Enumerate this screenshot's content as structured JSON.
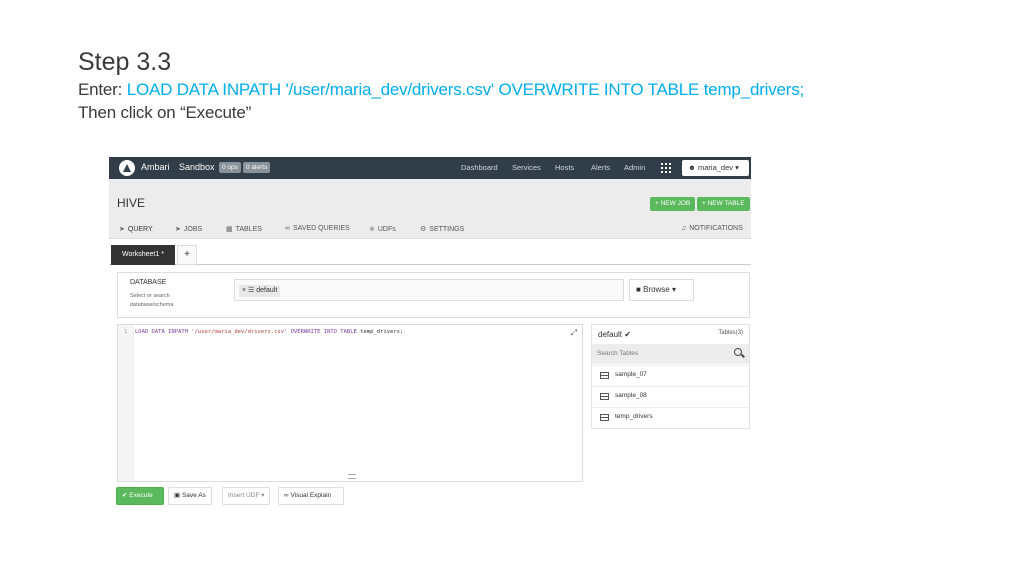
{
  "slide": {
    "title": "Step 3.3",
    "enter_prefix": "Enter: ",
    "command": "LOAD DATA INPATH '/user/maria_dev/drivers.csv' OVERWRITE INTO TABLE temp_drivers;",
    "then_line": "Then click on “Execute”"
  },
  "topnav": {
    "brand": "Ambari",
    "cluster": "Sandbox",
    "ops_badge": "0 ops",
    "alerts_badge": "0 alerts",
    "links": [
      "Dashboard",
      "Services",
      "Hosts",
      "Alerts",
      "Admin"
    ],
    "user": "maria_dev ▾"
  },
  "hive": {
    "title": "HIVE",
    "new_job": "+ NEW JOB",
    "new_table": "+ NEW TABLE",
    "subnav": {
      "query": "QUERY",
      "jobs": "JOBS",
      "tables": "TABLES",
      "saved": "SAVED QUERIES",
      "udfs": "UDFs",
      "settings": "SETTINGS",
      "notifications": "NOTIFICATIONS"
    }
  },
  "worksheet": {
    "tab_label": "Worksheet1 *",
    "add": "+"
  },
  "database": {
    "label": "DATABASE",
    "hint": "Select or search database/schema",
    "selected": "default",
    "browse": "Browse ▾"
  },
  "editor": {
    "line_number": "1",
    "kw1": "LOAD DATA INPATH",
    "path": "'/user/maria_dev/drivers.csv'",
    "kw2": "OVERWRITE INTO TABLE",
    "table": "temp_drivers;"
  },
  "sidebar": {
    "db": "default ✔",
    "count": "Tables(3)",
    "search_placeholder": "Search Tables",
    "tables": [
      "sample_07",
      "sample_08",
      "temp_drivers"
    ]
  },
  "actions": {
    "execute": "✔ Execute",
    "save_as": "Save As",
    "insert_udf": "Insert UDF ▾",
    "visual_explain": "Visual Explain"
  },
  "colors": {
    "command_blue": "#00aeef",
    "nav_bg": "#313d48",
    "green": "#5cb85c"
  }
}
